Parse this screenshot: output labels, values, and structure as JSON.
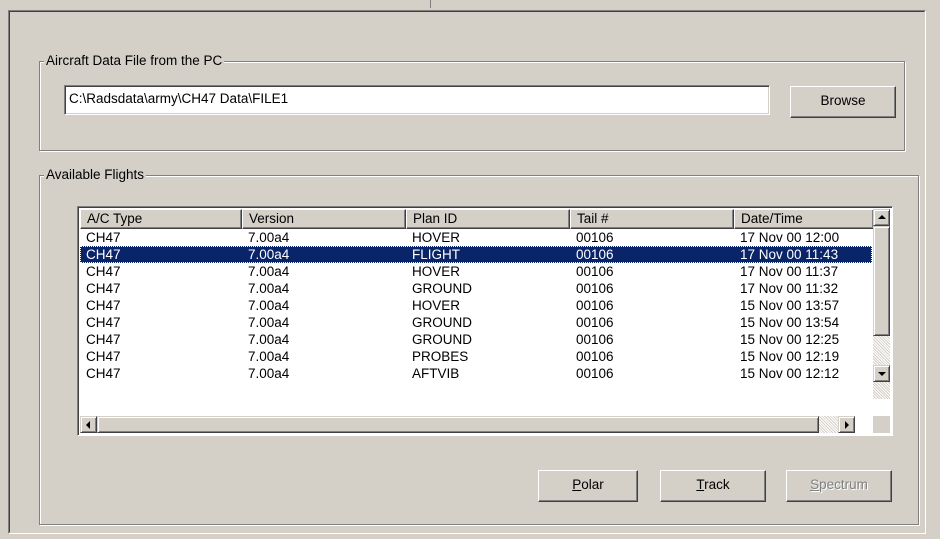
{
  "file_group": {
    "label": "Aircraft Data File from the PC",
    "path_value": "C:\\Radsdata\\army\\CH47 Data\\FILE1",
    "browse_label": "Browse"
  },
  "flights_group": {
    "label": "Available Flights",
    "columns": [
      "A/C Type",
      "Version",
      "Plan ID",
      "Tail #",
      "Date/Time"
    ],
    "rows": [
      [
        "CH47",
        "7.00a4",
        "HOVER",
        "00106",
        "17 Nov 00 12:00"
      ],
      [
        "CH47",
        "7.00a4",
        "FLIGHT",
        "00106",
        "17 Nov 00 11:43"
      ],
      [
        "CH47",
        "7.00a4",
        "HOVER",
        "00106",
        "17 Nov 00 11:37"
      ],
      [
        "CH47",
        "7.00a4",
        "GROUND",
        "00106",
        "17 Nov 00 11:32"
      ],
      [
        "CH47",
        "7.00a4",
        "HOVER",
        "00106",
        "15 Nov 00 13:57"
      ],
      [
        "CH47",
        "7.00a4",
        "GROUND",
        "00106",
        "15 Nov 00 13:54"
      ],
      [
        "CH47",
        "7.00a4",
        "GROUND",
        "00106",
        "15 Nov 00 12:25"
      ],
      [
        "CH47",
        "7.00a4",
        "PROBES",
        "00106",
        "15 Nov 00 12:19"
      ],
      [
        "CH47",
        "7.00a4",
        "AFTVIB",
        "00106",
        "15 Nov 00 12:12"
      ]
    ],
    "selected_row": 1
  },
  "actions": {
    "polar": {
      "accel": "P",
      "rest": "olar"
    },
    "track": {
      "accel": "T",
      "rest": "rack"
    },
    "spectrum": {
      "accel": "S",
      "rest": "pectrum",
      "disabled": true
    }
  },
  "colors": {
    "face": "#d4d0c8",
    "selection": "#0a246a"
  },
  "icons": [
    "arrow-up-icon",
    "arrow-down-icon",
    "arrow-left-icon",
    "arrow-right-icon"
  ]
}
